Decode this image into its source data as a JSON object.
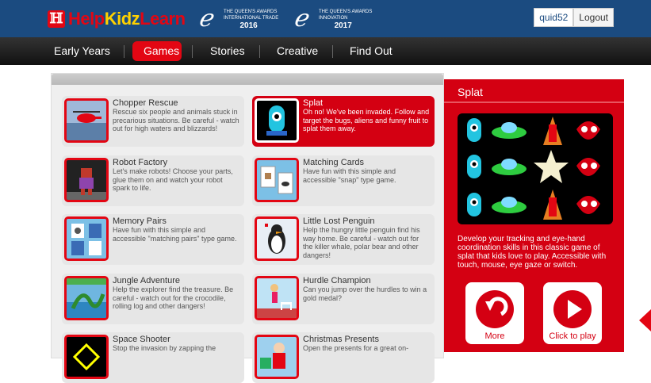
{
  "header": {
    "logo_text_1": "Help",
    "logo_text_2": "Kidz",
    "logo_text_3": "Learn",
    "awards": [
      {
        "line1": "The Queen's Awards",
        "line2": "International Trade",
        "year": "2016"
      },
      {
        "line1": "The Queen's Awards",
        "line2": "Innovation",
        "year": "2017"
      }
    ],
    "username": "quid52",
    "logout_label": "Logout"
  },
  "nav": {
    "items": [
      "Early Years",
      "Games",
      "Stories",
      "Creative",
      "Find Out"
    ],
    "active": "Games"
  },
  "games": [
    {
      "title": "Chopper Rescue",
      "desc": "Rescue six people and animals stuck in precarious situations. Be careful - watch out for high waters and blizzards!"
    },
    {
      "title": "Splat",
      "desc": "Oh no! We've been invaded. Follow and target the bugs, aliens and funny fruit to splat them away."
    },
    {
      "title": "Robot Factory",
      "desc": "Let's make robots! Choose your parts, glue them on and watch your robot spark to life."
    },
    {
      "title": "Matching Cards",
      "desc": "Have fun with this simple and accessible \"snap\" type game."
    },
    {
      "title": "Memory Pairs",
      "desc": "Have fun with this simple and accessible \"matching pairs\" type game."
    },
    {
      "title": "Little Lost Penguin",
      "desc": "Help the hungry little penguin find his way home. Be careful - watch out for the killer whale, polar bear and other dangers!"
    },
    {
      "title": "Jungle Adventure",
      "desc": "Help the explorer find the treasure. Be careful - watch out for the crocodile, rolling log and other dangers!"
    },
    {
      "title": "Hurdle Champion",
      "desc": "Can you jump over the hurdles to win a gold medal?"
    },
    {
      "title": "Space Shooter",
      "desc": "Stop the invasion by zapping the"
    },
    {
      "title": "Christmas Presents",
      "desc": "Open the presents for a great on-"
    }
  ],
  "side": {
    "title": "Splat",
    "desc": "Develop your tracking and eye-hand coordination skills in this classic game of splat that kids love to play. Accessible with touch, mouse, eye gaze or switch.",
    "more_label": "More",
    "play_label": "Click to play"
  },
  "colors": {
    "brand_red": "#e30613",
    "header_blue": "#1b4b80",
    "panel_red": "#d40012"
  }
}
